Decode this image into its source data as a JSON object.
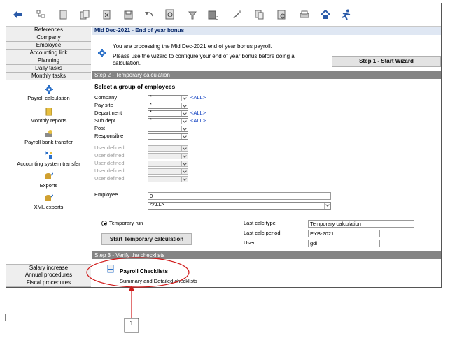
{
  "sidebar": {
    "nav_top": [
      "References",
      "Company",
      "Employee",
      "Accounting link",
      "Planning",
      "Daily tasks",
      "Monthly tasks"
    ],
    "items": [
      "Payroll calculation",
      "Monthly reports",
      "Payroll bank transfer",
      "Accounting system transfer",
      "Exports",
      "XML exports"
    ],
    "nav_bottom": [
      "Salary increase",
      "Annual procedures",
      "Fiscal procedures"
    ]
  },
  "header": {
    "title": "Mid Dec-2021 - End of year bonus"
  },
  "info": {
    "line1": "You are processing the Mid Dec-2021 end of year bonus payroll.",
    "line2": "Please use the wizard to configure your end of year bonus before doing a",
    "line3": "calculation.",
    "wizard_button": "Step 1 - Start Wizard"
  },
  "step2": {
    "title": "Step 2 - Temporary calculation",
    "group_title": "Select a group of employees",
    "filters": [
      {
        "label": "Company",
        "value": "*",
        "all": "<ALL>"
      },
      {
        "label": "Pay site",
        "value": "*",
        "all": ""
      },
      {
        "label": "Department",
        "value": "*",
        "all": "<ALL>"
      },
      {
        "label": "Sub dept",
        "value": "*",
        "all": "<ALL>"
      },
      {
        "label": "Post",
        "value": "",
        "all": ""
      },
      {
        "label": "Responsible",
        "value": "",
        "all": ""
      }
    ],
    "user_defined": [
      "User defined",
      "User defined",
      "User defined",
      "User defined",
      "User defined"
    ],
    "employee_label": "Employee",
    "employee_value": "0",
    "employee_select": "<ALL>",
    "radio_label": "Temporary run",
    "start_button": "Start Temporary calculation",
    "fields": [
      {
        "label": "Last calc type",
        "value": "Temporary calculation"
      },
      {
        "label": "Last calc period",
        "value": "EYB-2021"
      },
      {
        "label": "User",
        "value": "gdi"
      }
    ]
  },
  "step3": {
    "title": "Step 3 - Verify the checklists",
    "checklist_title": "Payroll Checklists",
    "checklist_sub": "Summary and Detailed checklists"
  },
  "annotation": {
    "number": "1"
  },
  "colors": {
    "section_bar": "#848484",
    "header_bg": "#dfe7f3",
    "link_blue": "#1040c0",
    "annotation_red": "#d01818"
  }
}
